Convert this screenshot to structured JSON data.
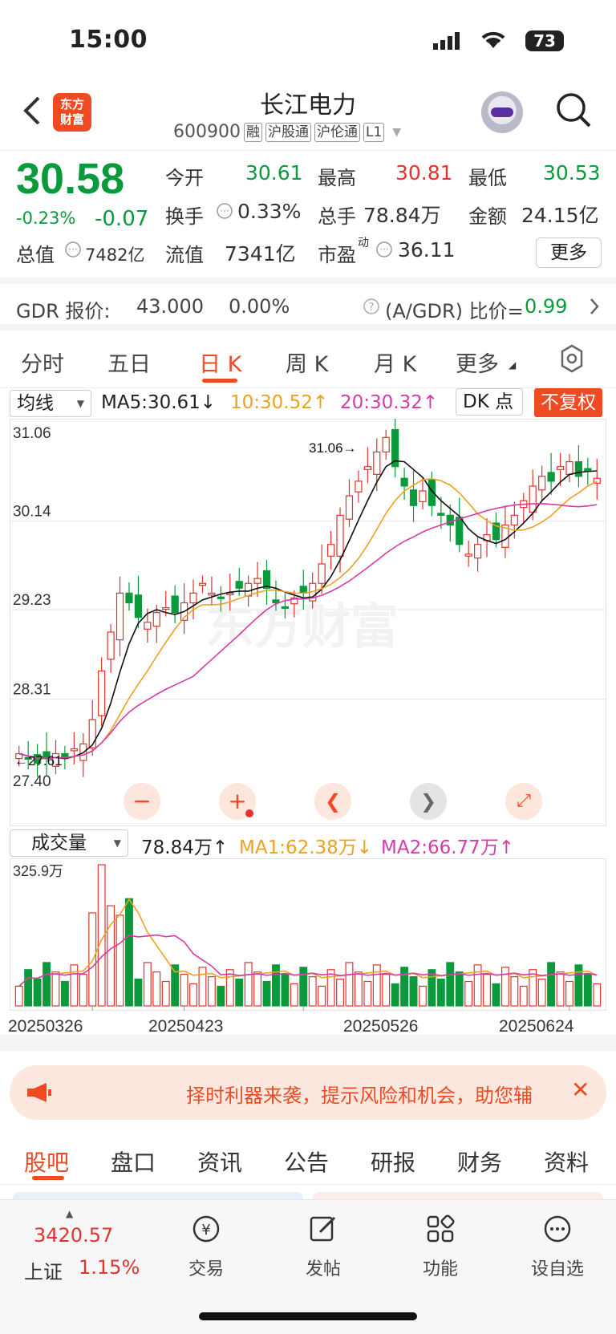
{
  "status_bar": {
    "time": "15:00",
    "battery": "73"
  },
  "header": {
    "logo_line1": "东方",
    "logo_line2": "财富",
    "stock_name": "长江电力",
    "stock_code": "600900",
    "tags": [
      "融",
      "沪股通",
      "沪伦通",
      "L1"
    ]
  },
  "quote": {
    "price": "30.58",
    "change_pct": "-0.23%",
    "change": "-0.07",
    "open_label": "今开",
    "open": "30.61",
    "high_label": "最高",
    "high": "30.81",
    "low_label": "最低",
    "low": "30.53",
    "turnover_label": "换手",
    "turnover": "0.33%",
    "volume_label": "总手",
    "volume": "78.84万",
    "amount_label": "金额",
    "amount": "24.15亿",
    "mktcap_label": "总值",
    "mktcap": "7482亿",
    "float_label": "流值",
    "float_cap": "7341亿",
    "pe_label": "市盈",
    "pe_sup": "动",
    "pe": "36.11",
    "more": "更多"
  },
  "gdr": {
    "label": "GDR 报价:",
    "price": "43.000",
    "pct": "0.00%",
    "ratio_label": "(A/GDR) 比价=",
    "ratio": "0.99"
  },
  "period_tabs": [
    "分时",
    "五日",
    "日 K",
    "周 K",
    "月 K",
    "更多"
  ],
  "chart_header": {
    "select": "均线",
    "ma5": "MA5:30.61↓",
    "ma10": "10:30.52↑",
    "ma20": "20:30.32↑",
    "dk": "DK 点",
    "fq": "不复权"
  },
  "price_axis": [
    "31.06",
    "30.14",
    "29.23",
    "28.31",
    "27.40"
  ],
  "annotations": {
    "high": "31.06→",
    "low": "←27.61"
  },
  "watermark": "东方财富",
  "volume_header": {
    "select": "成交量",
    "vol": "78.84万↑",
    "ma1": "MA1:62.38万↓",
    "ma2": "MA2:66.77万↑",
    "max": "325.9万"
  },
  "date_axis": [
    "20250326",
    "20250423",
    "20250526",
    "20250624"
  ],
  "banner": {
    "text": "择时利器来袭，提示风险和机会，助您辅"
  },
  "content_tabs": [
    "股吧",
    "盘口",
    "资讯",
    "公告",
    "研报",
    "财务",
    "资料"
  ],
  "footer": {
    "index_value": "3420.57",
    "index_name": "上证",
    "index_pct": "1.15%",
    "items": [
      "交易",
      "发帖",
      "功能",
      "设自选"
    ]
  },
  "colors": {
    "up": "#e5322d",
    "down": "#0a9a3c",
    "ma10": "#f0a020",
    "ma20": "#d63ba7",
    "accent": "#ef4a22"
  }
}
